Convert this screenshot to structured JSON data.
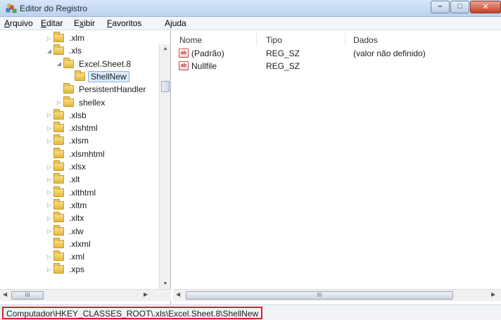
{
  "window": {
    "title": "Editor do Registro",
    "buttons": {
      "minimize": "–",
      "maximize": "□",
      "close": "✕"
    }
  },
  "menu": {
    "items": [
      {
        "label": "Arquivo",
        "access_key": "A"
      },
      {
        "label": "Editar",
        "access_key": "E"
      },
      {
        "label": "Exibir",
        "access_key": "x"
      },
      {
        "label": "Favoritos",
        "access_key": "F"
      },
      {
        "label": "Ajuda",
        "access_key": "j"
      }
    ]
  },
  "tree": {
    "items": [
      {
        "label": ".xlm",
        "expander": "▷"
      },
      {
        "label": ".xls",
        "expander": "◢"
      },
      {
        "label": "Excel.Sheet.8",
        "expander": "◢"
      },
      {
        "label": "ShellNew",
        "expander": "",
        "selected": true
      },
      {
        "label": "PersistentHandler",
        "expander": ""
      },
      {
        "label": "shellex",
        "expander": "▷"
      },
      {
        "label": ".xlsb",
        "expander": "▷"
      },
      {
        "label": ".xlshtml",
        "expander": "▷"
      },
      {
        "label": ".xlsm",
        "expander": "▷"
      },
      {
        "label": ".xlsmhtml",
        "expander": ""
      },
      {
        "label": ".xlsx",
        "expander": "▷"
      },
      {
        "label": ".xlt",
        "expander": "▷"
      },
      {
        "label": ".xlthtml",
        "expander": "▷"
      },
      {
        "label": ".xltm",
        "expander": "▷"
      },
      {
        "label": ".xltx",
        "expander": "▷"
      },
      {
        "label": ".xlw",
        "expander": "▷"
      },
      {
        "label": ".xlxml",
        "expander": ""
      },
      {
        "label": ".xml",
        "expander": "▷"
      },
      {
        "label": ".xps",
        "expander": "▷"
      }
    ],
    "scroll_thumb_label": "III"
  },
  "list": {
    "columns": {
      "name": "Nome",
      "type": "Tipo",
      "data": "Dados"
    },
    "rows": [
      {
        "name": "(Padrão)",
        "type": "REG_SZ",
        "data": "(valor não definido)",
        "icon": "ab-icon"
      },
      {
        "name": "Nullfile",
        "type": "REG_SZ",
        "data": "",
        "icon": "ab-icon"
      }
    ],
    "scroll_thumb_label": "III",
    "icon_text": "ab"
  },
  "status": {
    "path": "Computador\\HKEY_CLASSES_ROOT\\.xls\\Excel.Sheet.8\\ShellNew"
  },
  "colors": {
    "selection_bg": "#dbe9fb",
    "status_highlight": "#e0202c"
  }
}
